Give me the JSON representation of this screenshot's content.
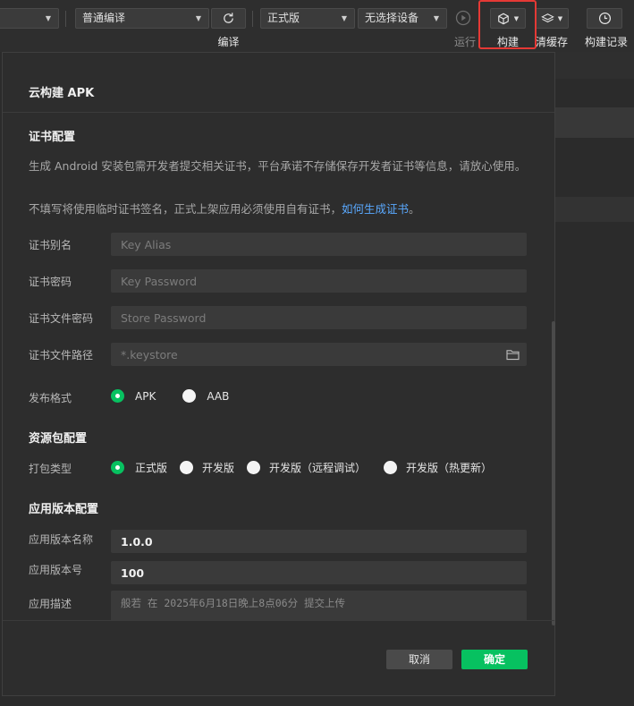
{
  "toolbar": {
    "mode_select": "普通编译",
    "refresh_label": "编译",
    "version_select": "正式版",
    "device_select": "无选择设备",
    "run_label": "运行",
    "build_label": "构建",
    "clear_cache_label": "清缓存",
    "build_history_label": "构建记录"
  },
  "dialog": {
    "title": "云构建 APK",
    "cert_section": "证书配置",
    "cert_desc_1": "生成 Android 安装包需开发者提交相关证书，平台承诺不存储保存开发者证书等信息，请放心使用。",
    "cert_desc_2": "不填写将使用临时证书签名，正式上架应用必须使用自有证书，",
    "cert_desc_link": "如何生成证书",
    "cert_desc_end": "。",
    "fields": {
      "alias_label": "证书别名",
      "alias_placeholder": "Key Alias",
      "password_label": "证书密码",
      "password_placeholder": "Key Password",
      "store_password_label": "证书文件密码",
      "store_password_placeholder": "Store Password",
      "path_label": "证书文件路径",
      "path_placeholder": "*.keystore"
    },
    "format_label": "发布格式",
    "format_options": [
      "APK",
      "AAB"
    ],
    "resource_section": "资源包配置",
    "package_type_label": "打包类型",
    "package_type_options": [
      "正式版",
      "开发版",
      "开发版（远程调试）",
      "开发版（热更新）"
    ],
    "app_version_section": "应用版本配置",
    "version_name_label": "应用版本名称",
    "version_name_value": "1.0.0",
    "version_code_label": "应用版本号",
    "version_code_value": "100",
    "description_label": "应用描述",
    "description_value": "般若 在 2025年6月18日晚上8点06分 提交上传",
    "cancel_label": "取消",
    "ok_label": "确定"
  },
  "colors": {
    "accent": "#07c160",
    "link": "#5aa9ff",
    "highlight": "#e53935"
  }
}
